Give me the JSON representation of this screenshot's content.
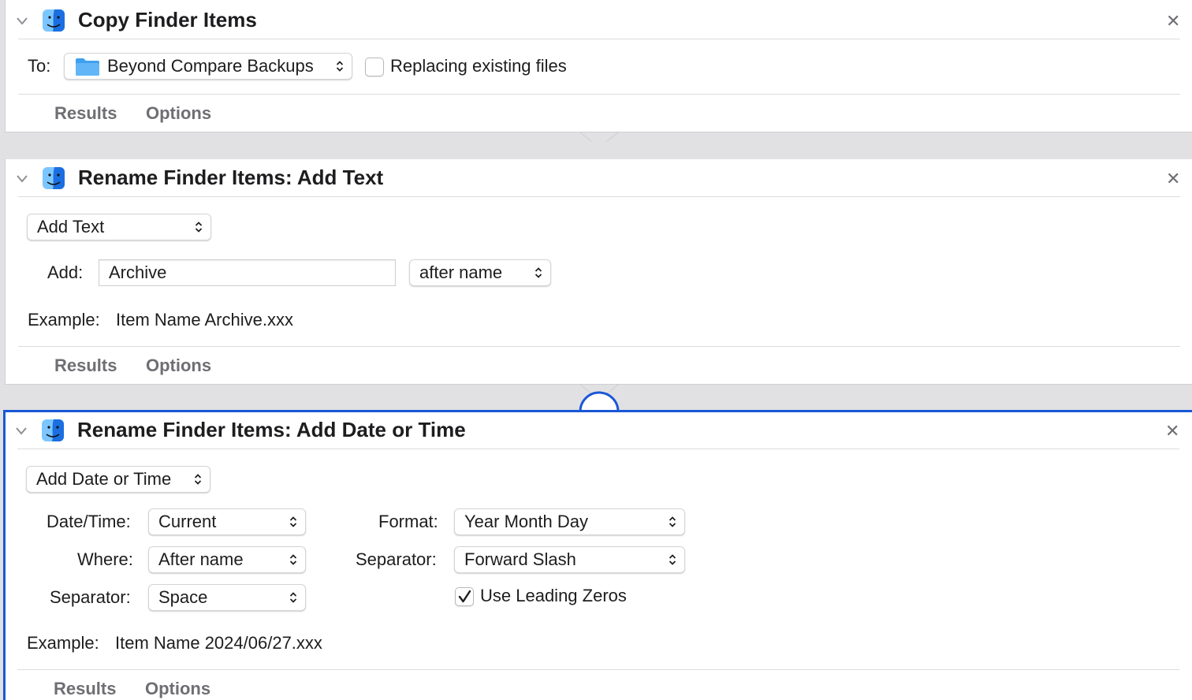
{
  "actions": [
    {
      "title": "Copy Finder Items",
      "icon": "finder-icon",
      "to_label": "To:",
      "destination": "Beyond Compare Backups",
      "replace_label": "Replacing existing files",
      "replace_checked": false,
      "results_label": "Results",
      "options_label": "Options"
    },
    {
      "title": "Rename Finder Items: Add Text",
      "icon": "finder-icon",
      "mode": "Add Text",
      "add_label": "Add:",
      "add_value": "Archive",
      "position": "after name",
      "example_label": "Example:",
      "example_value": "Item Name Archive.xxx",
      "results_label": "Results",
      "options_label": "Options"
    },
    {
      "title": "Rename Finder Items: Add Date or Time",
      "icon": "finder-icon",
      "mode": "Add Date or Time",
      "datetime_label": "Date/Time:",
      "datetime_value": "Current",
      "where_label": "Where:",
      "where_value": "After name",
      "separator_label": "Separator:",
      "separator_value": "Space",
      "format_label": "Format:",
      "format_value": "Year Month Day",
      "separator2_label": "Separator:",
      "separator2_value": "Forward Slash",
      "leading_zeros_label": "Use Leading Zeros",
      "leading_zeros_checked": true,
      "example_label": "Example:",
      "example_value": "Item Name 2024/06/27.xxx",
      "results_label": "Results",
      "options_label": "Options"
    }
  ],
  "colors": {
    "selection": "#1a57d6",
    "background": "#e1e1e4",
    "folder": "#3fa0f0"
  }
}
